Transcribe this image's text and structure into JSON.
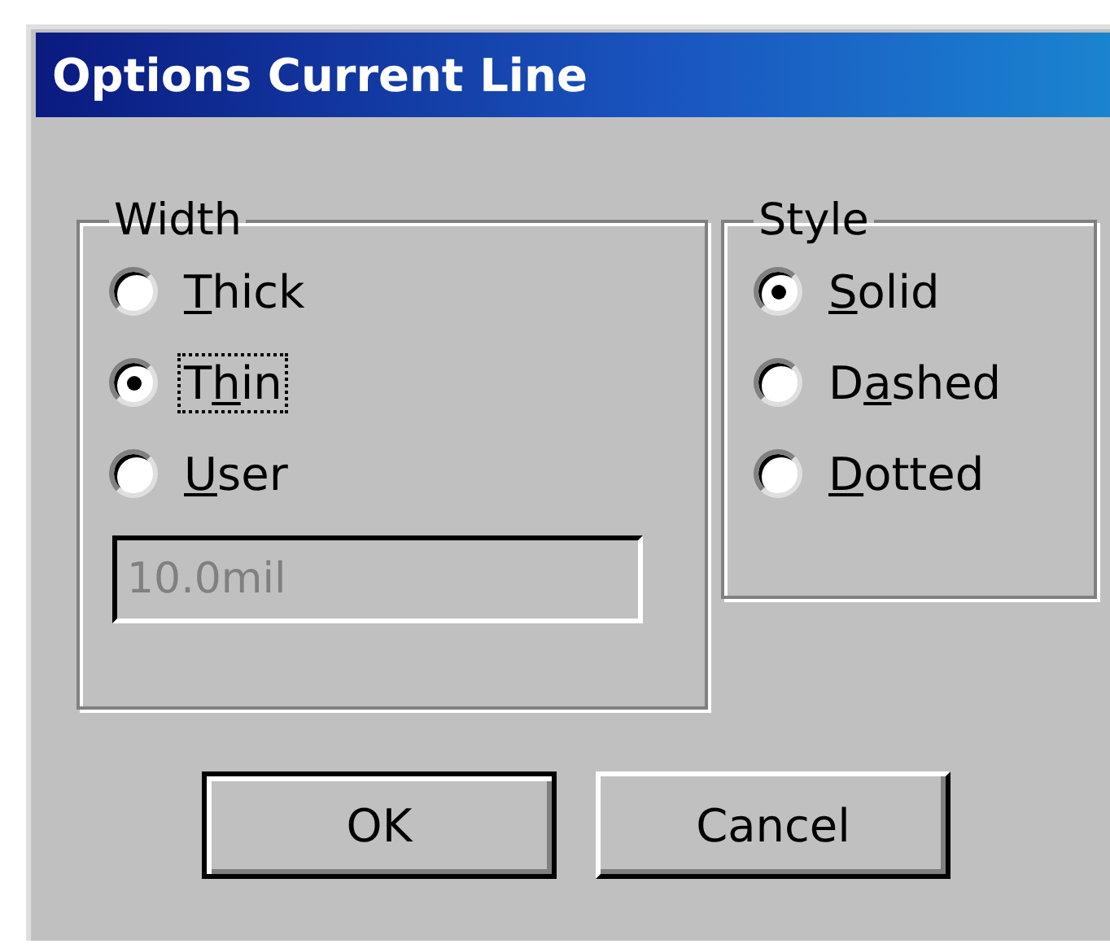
{
  "window": {
    "title": "Options Current Line"
  },
  "groups": [
    {
      "title": "Width",
      "options": [
        {
          "key": "T",
          "after": "hick",
          "selected": false,
          "focused": false
        },
        {
          "before": "T",
          "key": "h",
          "after": "in",
          "selected": true,
          "focused": true
        },
        {
          "key": "U",
          "after": "ser",
          "selected": false,
          "focused": false
        }
      ],
      "field": {
        "value": "10.0mil",
        "disabled": true
      }
    },
    {
      "title": "Style",
      "options": [
        {
          "key": "S",
          "after": "olid",
          "selected": true,
          "focused": false
        },
        {
          "before": "D",
          "key": "a",
          "after": "shed",
          "selected": false,
          "focused": false
        },
        {
          "key": "D",
          "after": "otted",
          "selected": false,
          "focused": false
        }
      ]
    }
  ],
  "buttons": [
    {
      "label": "OK",
      "default": true
    },
    {
      "label": "Cancel",
      "default": false
    }
  ]
}
